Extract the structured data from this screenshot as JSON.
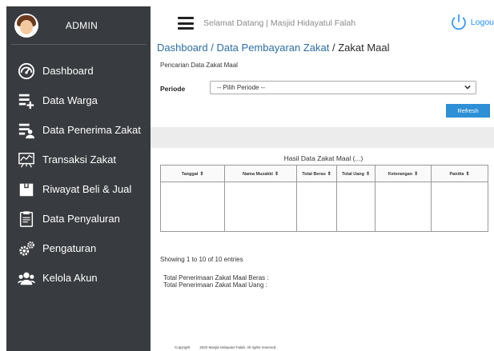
{
  "sidebar": {
    "admin_label": "ADMIN",
    "items": [
      {
        "label": "Dashboard",
        "icon": "dashboard-gauge-icon"
      },
      {
        "label": "Data Warga",
        "icon": "list-add-icon"
      },
      {
        "label": "Data Penerima Zakat",
        "icon": "list-user-icon"
      },
      {
        "label": "Transaksi Zakat",
        "icon": "chart-board-icon"
      },
      {
        "label": "Riwayat Beli & Jual",
        "icon": "box-icon"
      },
      {
        "label": "Data Penyaluran",
        "icon": "clipboard-icon"
      },
      {
        "label": "Pengaturan",
        "icon": "gears-icon"
      },
      {
        "label": "Kelola Akun",
        "icon": "users-icon"
      }
    ]
  },
  "header": {
    "welcome_text": "Selamat Datang | Masjid Hidayatul Falah",
    "logout_label": "Logou"
  },
  "breadcrumb": {
    "dashboard": "Dashboard",
    "sep1": " / ",
    "pembayaran": "Data Pembayaran Zakat",
    "sep2": " / ",
    "current": "Zakat Maal"
  },
  "search": {
    "title": "Pencarian Data Zakat Maal",
    "periode_label": "Periode",
    "periode_selected": "-- Pilih Periode --",
    "refresh_label": "Refresh"
  },
  "results": {
    "title": "Hasil Data Zakat Maal (...)",
    "columns": [
      "Tanggal",
      "Nama Muzakki",
      "Total Beras",
      "Total Uang",
      "Keterangan",
      "Panitia"
    ],
    "entries_text": "Showing 1 to 10 of 10 entries",
    "total_beras_label": "Total Penerimaan Zakat Maal Beras :",
    "total_uang_label": "Total Penerimaan Zakat Maal Uang :"
  },
  "footer": {
    "left": "Copyright",
    "right": "2022 Masjid Hidayatul Falah. All rights reserved."
  },
  "colors": {
    "sidebar_bg": "#383b3f",
    "accent_blue": "#2d8fd6",
    "breadcrumb_link": "#2c6ea8"
  }
}
